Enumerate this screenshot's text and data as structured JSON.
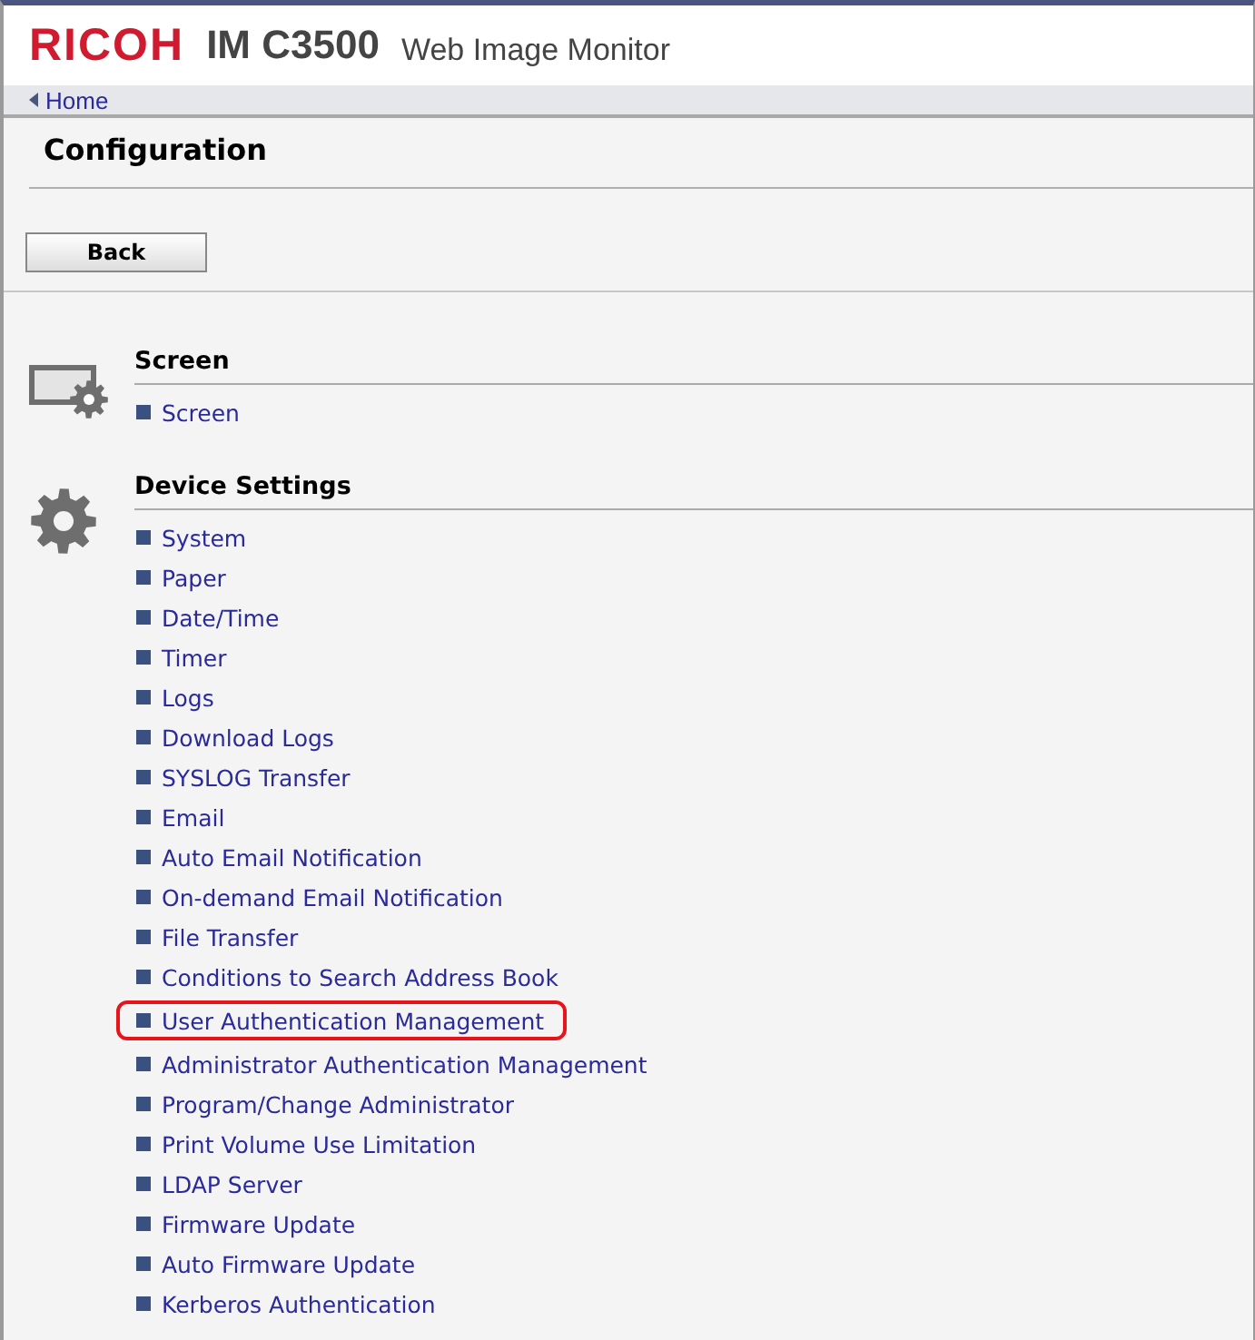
{
  "header": {
    "brand": "RICOH",
    "model": "IM C3500",
    "product": "Web Image Monitor"
  },
  "breadcrumb": {
    "label": "Home"
  },
  "page_title": "Configuration",
  "back_button": "Back",
  "sections": [
    {
      "title": "Screen",
      "kind": "screen",
      "items": [
        {
          "label": "Screen",
          "highlighted": false
        }
      ]
    },
    {
      "title": "Device Settings",
      "kind": "device",
      "items": [
        {
          "label": "System",
          "highlighted": false
        },
        {
          "label": "Paper",
          "highlighted": false
        },
        {
          "label": "Date/Time",
          "highlighted": false
        },
        {
          "label": "Timer",
          "highlighted": false
        },
        {
          "label": "Logs",
          "highlighted": false
        },
        {
          "label": "Download Logs",
          "highlighted": false
        },
        {
          "label": "SYSLOG Transfer",
          "highlighted": false
        },
        {
          "label": "Email",
          "highlighted": false
        },
        {
          "label": "Auto Email Notification",
          "highlighted": false
        },
        {
          "label": "On-demand Email Notification",
          "highlighted": false
        },
        {
          "label": "File Transfer",
          "highlighted": false
        },
        {
          "label": "Conditions to Search Address Book",
          "highlighted": false
        },
        {
          "label": "User Authentication Management",
          "highlighted": true
        },
        {
          "label": "Administrator Authentication Management",
          "highlighted": false
        },
        {
          "label": "Program/Change Administrator",
          "highlighted": false
        },
        {
          "label": "Print Volume Use Limitation",
          "highlighted": false
        },
        {
          "label": "LDAP Server",
          "highlighted": false
        },
        {
          "label": "Firmware Update",
          "highlighted": false
        },
        {
          "label": "Auto Firmware Update",
          "highlighted": false
        },
        {
          "label": "Kerberos Authentication",
          "highlighted": false
        }
      ]
    }
  ]
}
